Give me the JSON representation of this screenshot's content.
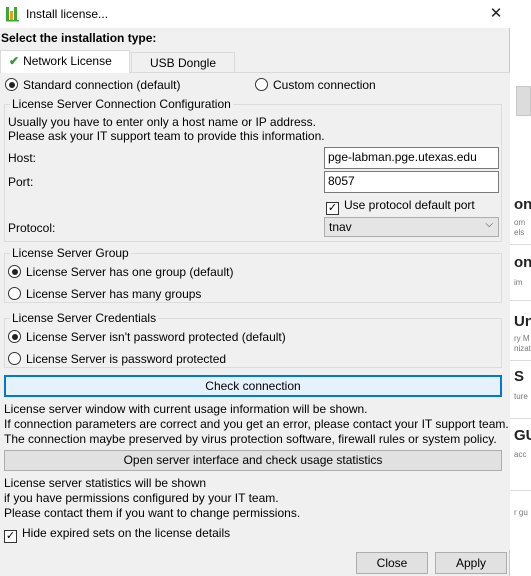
{
  "window": {
    "title": "Install license...",
    "close_glyph": "✕"
  },
  "heading": "Select the installation type:",
  "tabs": [
    {
      "label": "Network License",
      "active": true
    },
    {
      "label": "USB Dongle",
      "active": false
    }
  ],
  "connection": {
    "standard_label": "Standard connection (default)",
    "custom_label": "Custom connection",
    "selected": "standard"
  },
  "config": {
    "legend": "License Server Connection Configuration",
    "note_line1": "Usually you have to enter only a host name or IP address.",
    "note_line2": "Please ask your IT support team to provide this information.",
    "host_label": "Host:",
    "host_value": "pge-labman.pge.utexas.edu",
    "port_label": "Port:",
    "port_value": "8057",
    "default_port_label": "Use protocol default port",
    "default_port_checked": true,
    "protocol_label": "Protocol:",
    "protocol_value": "tnav"
  },
  "group": {
    "legend": "License Server Group",
    "option1": "License Server has one group (default)",
    "option2": "License Server has many groups",
    "selected": 1
  },
  "credentials": {
    "legend": "License Server Credentials",
    "option1": "License Server isn't password protected (default)",
    "option2": "License Server is password protected",
    "selected": 1
  },
  "check_button": "Check connection",
  "check_info": [
    "License server window with current usage information will be shown.",
    "If connection parameters are correct and you get an error, please contact your IT support team.",
    "The connection maybe preserved by virus protection software, firewall rules or system policy."
  ],
  "open_button": "Open server interface and check usage statistics",
  "stats_info": [
    "License server statistics will be shown",
    "if you have permissions configured by your IT team.",
    "Please contact them if you want to change permissions."
  ],
  "hide_expired": {
    "label": "Hide expired sets on the license details",
    "checked": true
  },
  "footer": {
    "close": "Close",
    "apply": "Apply"
  },
  "background_fragments": {
    "f1": "on",
    "f1s": "om",
    "f1t": "els",
    "f2": "on",
    "f2s": "im",
    "f3": "Un",
    "f3s": "ry M",
    "f3t": "nizat",
    "f4": "S",
    "f4s": "ture",
    "f5": "GU",
    "f5s": "acc",
    "f6": "r gu"
  },
  "colors": {
    "check_green": "#2e9a2e",
    "focus_blue": "#0078d7",
    "logo_green": "#3aaa35",
    "logo_orange": "#f29a1f"
  }
}
